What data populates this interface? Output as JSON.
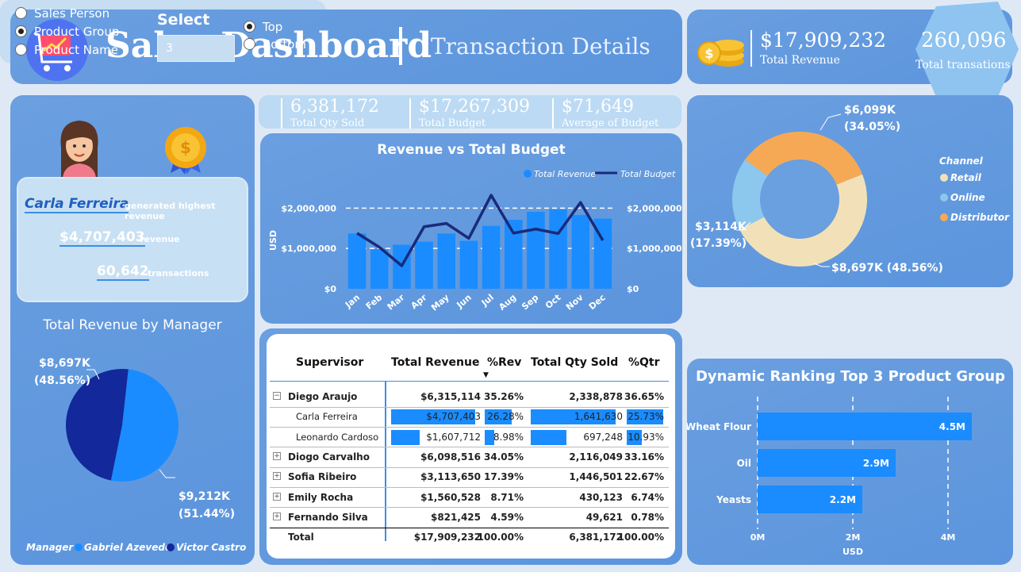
{
  "header": {
    "title": "Sales Dashboard",
    "subtitle": "Transaction Details"
  },
  "kpi_top": {
    "total_revenue": "$17,909,232",
    "total_revenue_label": "Total Revenue",
    "total_transactions": "260,096",
    "total_transactions_label": "Total transations"
  },
  "top_performer": {
    "name": "Carla Ferreira",
    "name_suffix": "generated highest revenue",
    "revenue": "$4,707,403",
    "revenue_label": "revenue",
    "transactions": "60,642",
    "transactions_label": "transactions"
  },
  "kpi_mid": [
    {
      "value": "6,381,172",
      "label": "Total Qty Sold"
    },
    {
      "value": "$17,267,309",
      "label": "Total Budget"
    },
    {
      "value": "$71,649",
      "label": "Average of Budget"
    }
  ],
  "colors": {
    "bar": "#1a8cff",
    "budget_line": "#1a2a7a",
    "retail": "#f2e1b8",
    "online": "#8cc7ee",
    "distributor": "#f6a955",
    "gabriel": "#1a8cff",
    "victor": "#13289a"
  },
  "chart_data": [
    {
      "type": "bar",
      "title": "Revenue vs Total Budget",
      "categories": [
        "Jan",
        "Feb",
        "Mar",
        "Apr",
        "May",
        "Jun",
        "Jul",
        "Aug",
        "Sep",
        "Oct",
        "Nov",
        "Dec"
      ],
      "series": [
        {
          "name": "Total Revenue",
          "type": "bar",
          "values": [
            1370000,
            980000,
            1090000,
            1170000,
            1370000,
            1190000,
            1560000,
            1710000,
            1910000,
            1970000,
            1830000,
            1740000
          ]
        },
        {
          "name": "Total Budget",
          "type": "line",
          "values": [
            1380000,
            1030000,
            570000,
            1540000,
            1620000,
            1250000,
            2320000,
            1380000,
            1480000,
            1370000,
            2140000,
            1200000
          ]
        }
      ],
      "ylabel": "USD",
      "ylim": [
        0,
        2400000
      ],
      "yticks": [
        "$0",
        "$1,000,000",
        "$2,000,000"
      ],
      "legend": "top-right",
      "grid": true
    },
    {
      "type": "pie",
      "title": "",
      "legend_title": "Channel",
      "labels": [
        "Retail",
        "Online",
        "Distributor"
      ],
      "values": [
        8697,
        3114,
        6099
      ],
      "data_labels": [
        "$8,697K (48.56%)",
        "$3,114K",
        "$6,099K"
      ],
      "data_labels_pct": [
        "",
        "(17.39%)",
        "(34.05%)"
      ],
      "donut": true
    },
    {
      "type": "pie",
      "title": "Total Revenue by Manager",
      "legend_title": "Manager",
      "labels": [
        "Gabriel Azevedo",
        "Victor Castro"
      ],
      "values": [
        9212,
        8697
      ],
      "data_labels": [
        "$9,212K",
        "$8,697K"
      ],
      "data_labels_pct": [
        "(51.44%)",
        "(48.56%)"
      ],
      "legend": "bottom"
    },
    {
      "type": "bar",
      "orientation": "horizontal",
      "title": "Dynamic Ranking Top 3 Product Group",
      "categories": [
        "Wheat Flour",
        "Oil",
        "Yeasts"
      ],
      "values": [
        4.5,
        2.9,
        2.2
      ],
      "value_labels": [
        "4.5M",
        "2.9M",
        "2.2M"
      ],
      "xlabel": "USD",
      "xticks": [
        "0M",
        "2M",
        "4M"
      ],
      "xlim": [
        0,
        5
      ],
      "grid": true
    }
  ],
  "slicer": {
    "options": [
      "Sales Person",
      "Product Group",
      "Product Name"
    ],
    "selected": "Product Group",
    "select_label": "Select",
    "select_value": "3",
    "direction": [
      "Top",
      "Bottom"
    ],
    "direction_selected": "Top"
  },
  "table": {
    "headers": [
      "Supervisor",
      "Total Revenue",
      "%Rev",
      "Total Qty Sold",
      "%Qtr"
    ],
    "rows": [
      {
        "name": "Diego Araujo",
        "rev": "$6,315,114",
        "prev": "35.26%",
        "qty": "2,338,878",
        "pqty": "36.65%",
        "level": 0,
        "expanded": true
      },
      {
        "name": "Carla Ferreira",
        "rev": "$4,707,403",
        "prev": "26.28%",
        "qty": "1,641,630",
        "pqty": "25.73%",
        "level": 1,
        "bar_rev": 1.0,
        "bar_prev": 1.0,
        "bar_qty": 1.0,
        "bar_pqty": 1.0
      },
      {
        "name": "Leonardo Cardoso",
        "rev": "$1,607,712",
        "prev": "8.98%",
        "qty": "697,248",
        "pqty": "10.93%",
        "level": 1,
        "bar_rev": 0.34,
        "bar_prev": 0.34,
        "bar_qty": 0.42,
        "bar_pqty": 0.42
      },
      {
        "name": "Diogo Carvalho",
        "rev": "$6,098,516",
        "prev": "34.05%",
        "qty": "2,116,049",
        "pqty": "33.16%",
        "level": 0
      },
      {
        "name": "Sofia Ribeiro",
        "rev": "$3,113,650",
        "prev": "17.39%",
        "qty": "1,446,501",
        "pqty": "22.67%",
        "level": 0
      },
      {
        "name": "Emily Rocha",
        "rev": "$1,560,528",
        "prev": "8.71%",
        "qty": "430,123",
        "pqty": "6.74%",
        "level": 0
      },
      {
        "name": "Fernando Silva",
        "rev": "$821,425",
        "prev": "4.59%",
        "qty": "49,621",
        "pqty": "0.78%",
        "level": 0
      }
    ],
    "total": {
      "name": "Total",
      "rev": "$17,909,232",
      "prev": "100.00%",
      "qty": "6,381,172",
      "pqty": "100.00%"
    }
  }
}
